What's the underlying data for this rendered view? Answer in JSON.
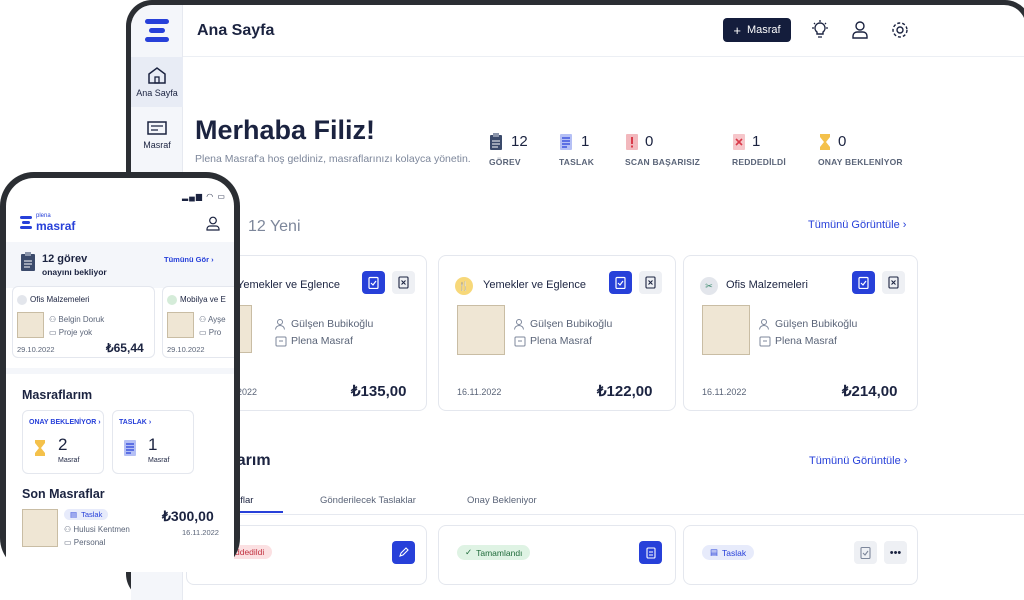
{
  "header": {
    "title": "Ana Sayfa",
    "add_button": "Masraf"
  },
  "sidebar": {
    "items": [
      {
        "label": "Ana Sayfa"
      },
      {
        "label": "Masraf"
      }
    ]
  },
  "welcome": {
    "title": "Merhaba Filiz!",
    "subtitle": "Plena Masraf'a hoş geldiniz, masraflarınızı kolayca yönetin."
  },
  "stats": [
    {
      "count": "12",
      "label": "GÖREV"
    },
    {
      "count": "1",
      "label": "TASLAK"
    },
    {
      "count": "0",
      "label": "SCAN BAŞARISIZ"
    },
    {
      "count": "1",
      "label": "REDDEDİLDİ"
    },
    {
      "count": "0",
      "label": "ONAY BEKLENİYOR"
    }
  ],
  "new_section": {
    "title": "12 Yeni",
    "view_all": "Tümünü Görüntüle"
  },
  "cards": [
    {
      "category": "Yemekler ve Eglence",
      "person": "Gülşen Bubikoğlu",
      "project": "Plena Masraf",
      "date": "2022",
      "amount": "₺135,00"
    },
    {
      "category": "Yemekler ve Eglence",
      "person": "Gülşen Bubikoğlu",
      "project": "Plena Masraf",
      "date": "16.11.2022",
      "amount": "₺122,00"
    },
    {
      "category": "Ofis Malzemeleri",
      "person": "Gülşen Bubikoğlu",
      "project": "Plena Masraf",
      "date": "16.11.2022",
      "amount": "₺214,00"
    }
  ],
  "expenses_section": {
    "title": "flarım",
    "view_all": "Tümünü Görüntüle"
  },
  "tabs": [
    {
      "label": "sraflar"
    },
    {
      "label": "Gönderilecek Taslaklar"
    },
    {
      "label": "Onay Bekleniyor"
    }
  ],
  "status_badges": {
    "rejected": "ddedildi",
    "completed": "Tamamlandı",
    "draft": "Taslak"
  },
  "phone": {
    "logo_small": "plena",
    "logo_big": "masraf",
    "status": "12 görev",
    "status_sub": "onayını bekliyor",
    "see_all": "Tümünü Gör",
    "mini_cards": [
      {
        "category": "Ofis Malzemeleri",
        "person": "Belgin Doruk",
        "project": "Proje yok",
        "date": "29.10.2022",
        "amount": "₺65,44"
      },
      {
        "category": "Mobilya ve E",
        "person": "Ayşe",
        "project": "Pro",
        "date": "29.10.2022"
      }
    ],
    "my_expenses": "Masraflarım",
    "pending": {
      "label": "ONAY BEKLENİYOR",
      "count": "2",
      "unit": "Masraf"
    },
    "draft": {
      "label": "TASLAK",
      "count": "1",
      "unit": "Masraf"
    },
    "recent_title": "Son Masraflar",
    "recent": {
      "badge": "Taslak",
      "person": "Hulusi Kentmen",
      "project": "Personal",
      "amount": "₺300,00",
      "date": "16.11.2022"
    }
  },
  "colors": {
    "accent": "#2740d9",
    "dark": "#141d3c"
  }
}
